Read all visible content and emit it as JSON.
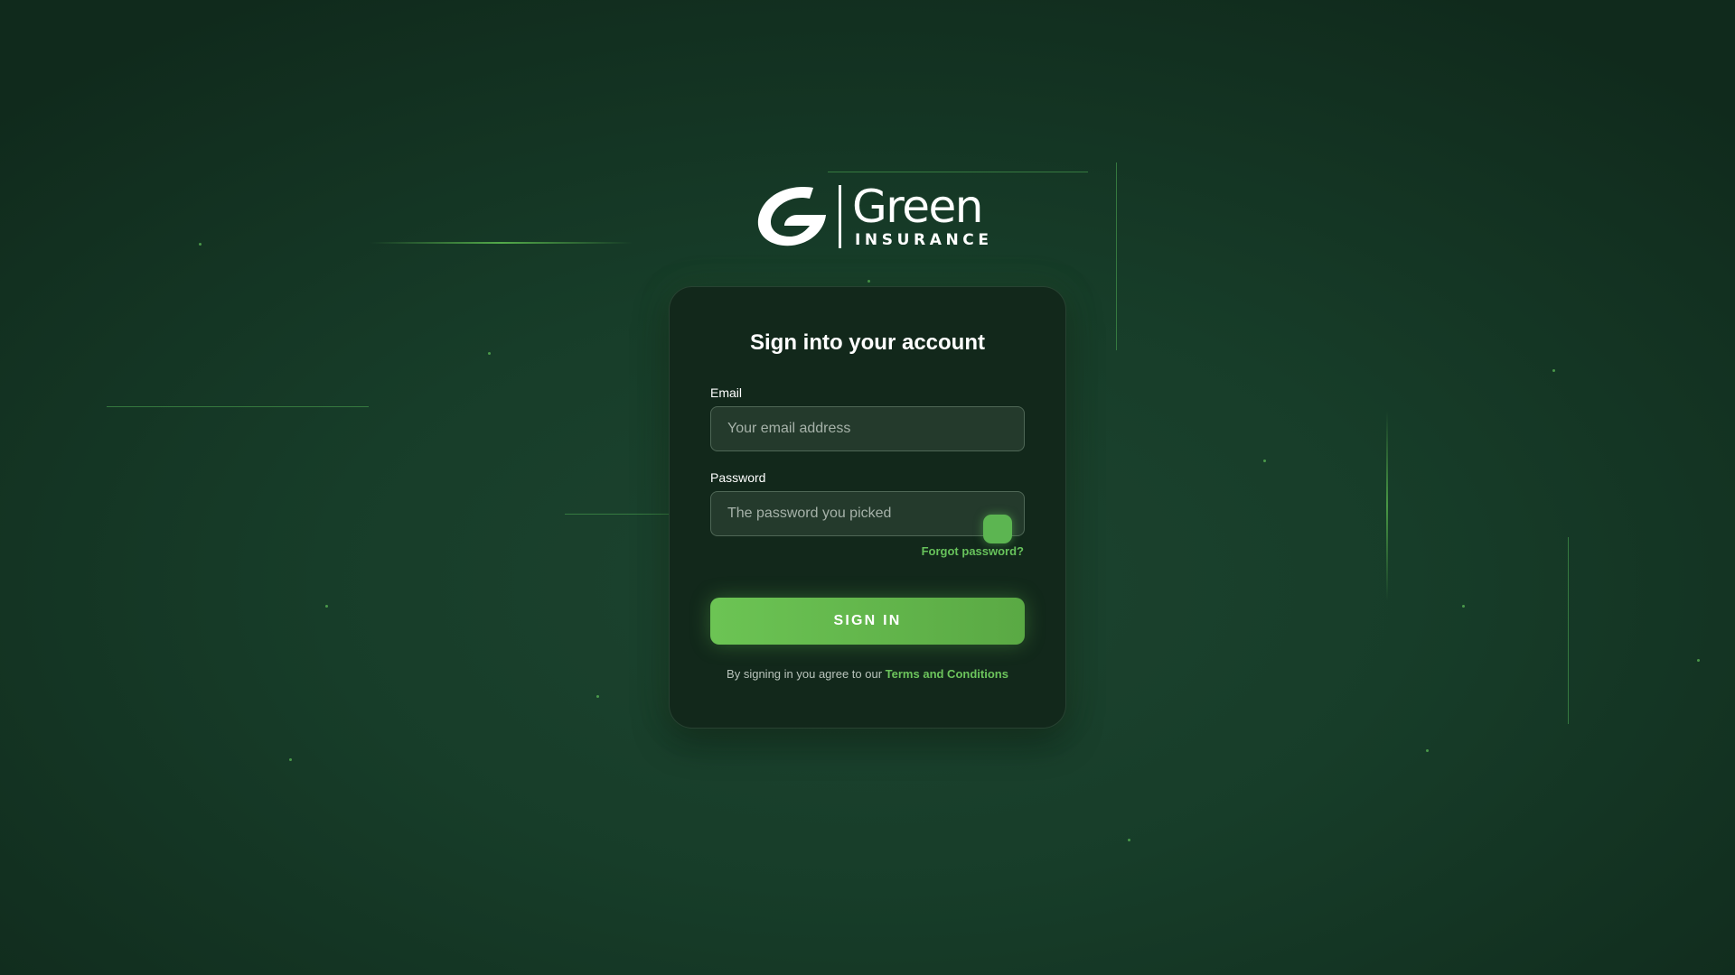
{
  "brand": {
    "name": "Green",
    "tagline": "INSURANCE",
    "logo_icon": "g-leaf-icon"
  },
  "login": {
    "title": "Sign into your account",
    "email": {
      "label": "Email",
      "placeholder": "Your email address",
      "value": ""
    },
    "password": {
      "label": "Password",
      "placeholder": "The password you picked",
      "value": "",
      "toggle_icon": "show-password-icon"
    },
    "forgot_link": "Forgot password?",
    "submit_label": "SIGN IN",
    "agreement_prefix": "By signing in you agree to our",
    "terms_link": "Terms and Conditions"
  },
  "colors": {
    "accent": "#6cc454",
    "background": "#173d29",
    "card": "#12281b"
  }
}
